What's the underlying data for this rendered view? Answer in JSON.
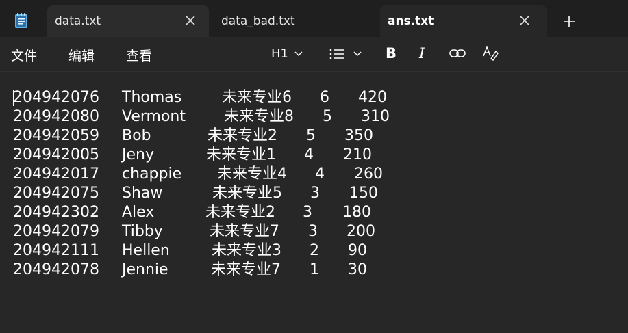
{
  "tabs": [
    {
      "label": "data.txt",
      "active": false
    },
    {
      "label": "data_bad.txt",
      "active": false
    },
    {
      "label": "ans.txt",
      "active": true
    }
  ],
  "menu": {
    "file": "文件",
    "edit": "编辑",
    "view": "查看"
  },
  "toolbar": {
    "heading": "H1",
    "bold": "B",
    "italic": "I"
  },
  "rows": [
    {
      "id": "204942076",
      "name": "Thomas",
      "major": "未来专业6",
      "n": "6",
      "score": "420"
    },
    {
      "id": "204942080",
      "name": "Vermont",
      "major": "未来专业8",
      "n": "5",
      "score": "310"
    },
    {
      "id": "204942059",
      "name": "Bob",
      "major": "未来专业2",
      "n": "5",
      "score": "350"
    },
    {
      "id": "204942005",
      "name": "Jeny",
      "major": "未来专业1",
      "n": "4",
      "score": "210"
    },
    {
      "id": "204942017",
      "name": "chappie",
      "major": "未来专业4",
      "n": "4",
      "score": "260"
    },
    {
      "id": "204942075",
      "name": "Shaw",
      "major": "未来专业5",
      "n": "3",
      "score": "150"
    },
    {
      "id": "204942302",
      "name": "Alex",
      "major": "未来专业2",
      "n": "3",
      "score": "180"
    },
    {
      "id": "204942079",
      "name": "Tibby",
      "major": "未来专业7",
      "n": "3",
      "score": "200"
    },
    {
      "id": "204942111",
      "name": "Hellen",
      "major": "未来专业3",
      "n": "2",
      "score": "90"
    },
    {
      "id": "204942078",
      "name": "Jennie",
      "major": "未来专业7",
      "n": "1",
      "score": "30"
    }
  ]
}
